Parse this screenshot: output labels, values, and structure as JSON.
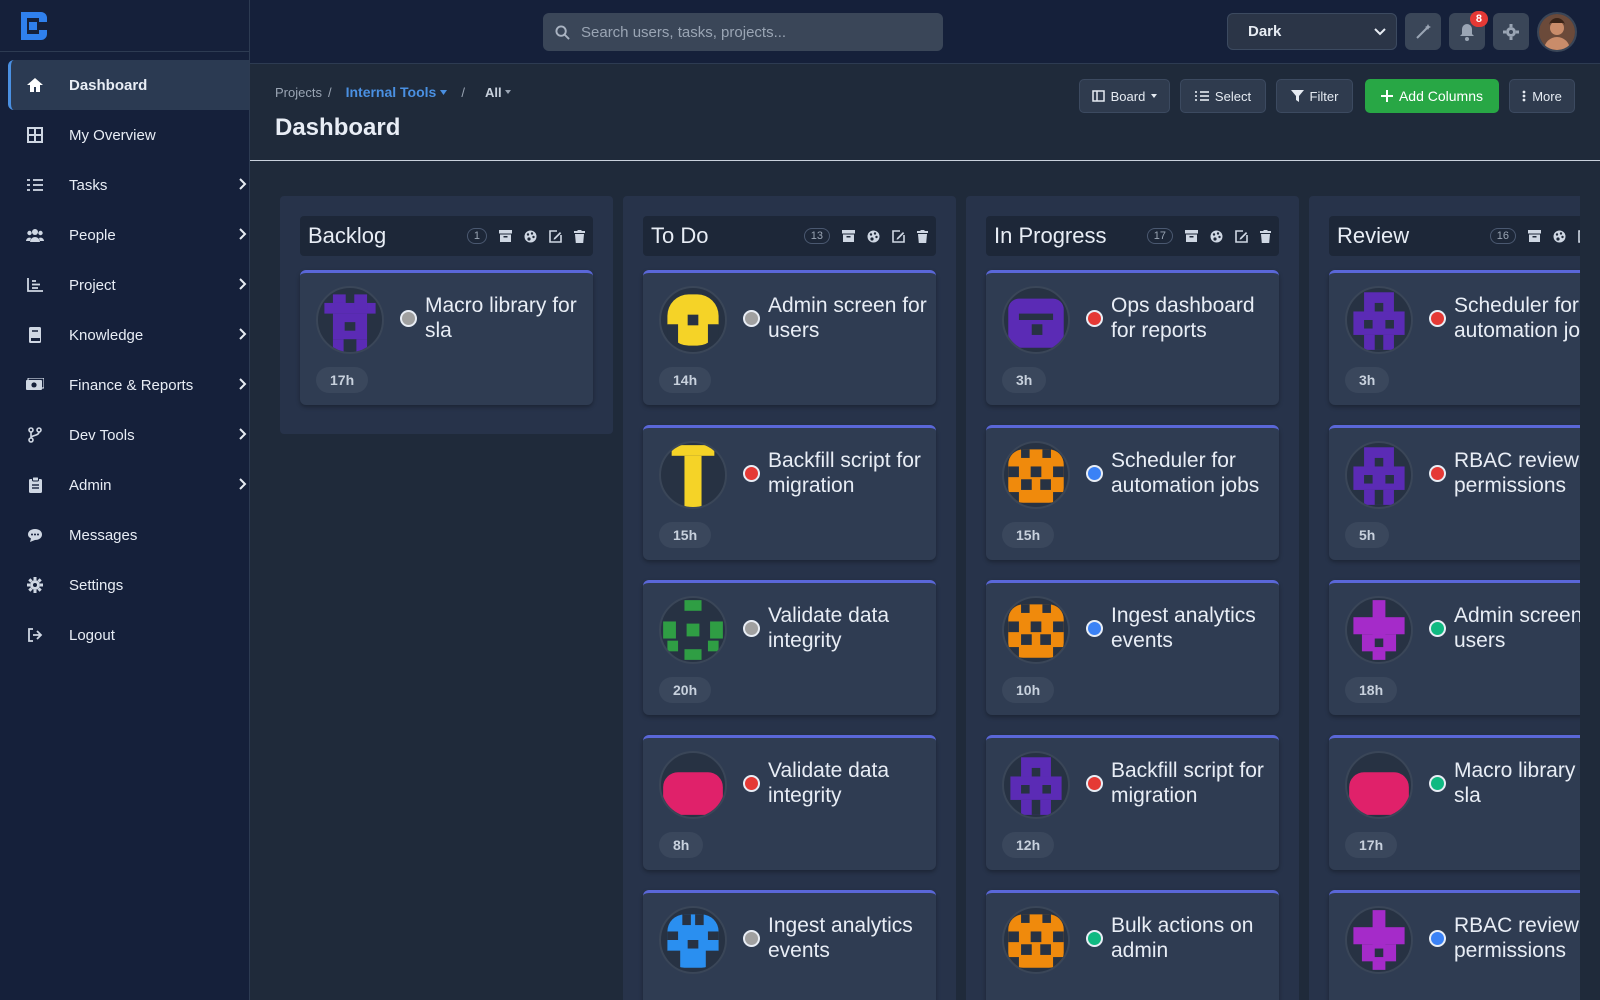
{
  "sidebar": {
    "items": [
      {
        "label": "Dashboard",
        "icon": "home-icon",
        "active": true,
        "chevron": false
      },
      {
        "label": "My Overview",
        "icon": "grid-icon",
        "chevron": false
      },
      {
        "label": "Tasks",
        "icon": "tasks-icon",
        "chevron": true
      },
      {
        "label": "People",
        "icon": "people-icon",
        "chevron": true
      },
      {
        "label": "Project",
        "icon": "chart-icon",
        "chevron": true
      },
      {
        "label": "Knowledge",
        "icon": "book-icon",
        "chevron": true
      },
      {
        "label": "Finance & Reports",
        "icon": "money-icon",
        "chevron": true
      },
      {
        "label": "Dev Tools",
        "icon": "branch-icon",
        "chevron": true
      },
      {
        "label": "Admin",
        "icon": "clipboard-icon",
        "chevron": true
      },
      {
        "label": "Messages",
        "icon": "chat-icon",
        "chevron": false
      },
      {
        "label": "Settings",
        "icon": "gear-icon",
        "chevron": false
      },
      {
        "label": "Logout",
        "icon": "logout-icon",
        "chevron": false
      }
    ]
  },
  "topbar": {
    "search_placeholder": "Search users, tasks, projects...",
    "theme": "Dark",
    "theme_options": [
      "Dark"
    ],
    "notifications_count": "8"
  },
  "header": {
    "crumb_projects": "Projects",
    "crumb_sep": "/",
    "crumb_project": "Internal Tools",
    "crumb_all": "All",
    "title": "Dashboard",
    "btn_board": "Board",
    "btn_select": "Select",
    "btn_filter": "Filter",
    "btn_add_columns": "Add Columns",
    "btn_more": "More"
  },
  "colors": {
    "accent": "#4a90e2",
    "green": "#28a745",
    "red": "#e53935",
    "blue": "#3b82f6",
    "teal": "#10b981",
    "grey": "#a0a0a0"
  },
  "columns": [
    {
      "title": "Backlog",
      "count": "1",
      "cards": [
        {
          "title": "Macro library for sla",
          "hours": "17h",
          "status": "grey",
          "avatar": "purple-a"
        }
      ]
    },
    {
      "title": "To Do",
      "count": "13",
      "cards": [
        {
          "title": "Admin screen for users",
          "hours": "14h",
          "status": "grey",
          "avatar": "yellow-a"
        },
        {
          "title": "Backfill script for migration",
          "hours": "15h",
          "status": "red",
          "avatar": "yellow-t"
        },
        {
          "title": "Validate data integrity",
          "hours": "20h",
          "status": "grey",
          "avatar": "green-x"
        },
        {
          "title": "Validate data integrity",
          "hours": "8h",
          "status": "red",
          "avatar": "pink-a"
        },
        {
          "title": "Ingest analytics events",
          "hours": "",
          "status": "grey",
          "avatar": "blue-a"
        }
      ]
    },
    {
      "title": "In Progress",
      "count": "17",
      "cards": [
        {
          "title": "Ops dashboard for reports",
          "hours": "3h",
          "status": "red",
          "avatar": "purple-b"
        },
        {
          "title": "Scheduler for automation jobs",
          "hours": "15h",
          "status": "blue",
          "avatar": "orange-a"
        },
        {
          "title": "Ingest analytics events",
          "hours": "10h",
          "status": "blue",
          "avatar": "orange-a"
        },
        {
          "title": "Backfill script for migration",
          "hours": "12h",
          "status": "red",
          "avatar": "purple-c"
        },
        {
          "title": "Bulk actions on admin",
          "hours": "",
          "status": "teal",
          "avatar": "orange-a"
        }
      ]
    },
    {
      "title": "Review",
      "count": "16",
      "cards": [
        {
          "title": "Scheduler for automation jobs",
          "hours": "3h",
          "status": "red",
          "avatar": "purple-c"
        },
        {
          "title": "RBAC review of permissions",
          "hours": "5h",
          "status": "red",
          "avatar": "purple-c"
        },
        {
          "title": "Admin screen for users",
          "hours": "18h",
          "status": "teal",
          "avatar": "magenta-a"
        },
        {
          "title": "Macro library for sla",
          "hours": "17h",
          "status": "teal",
          "avatar": "pink-a"
        },
        {
          "title": "RBAC review of permissions",
          "hours": "",
          "status": "blue",
          "avatar": "magenta-a"
        }
      ]
    }
  ]
}
